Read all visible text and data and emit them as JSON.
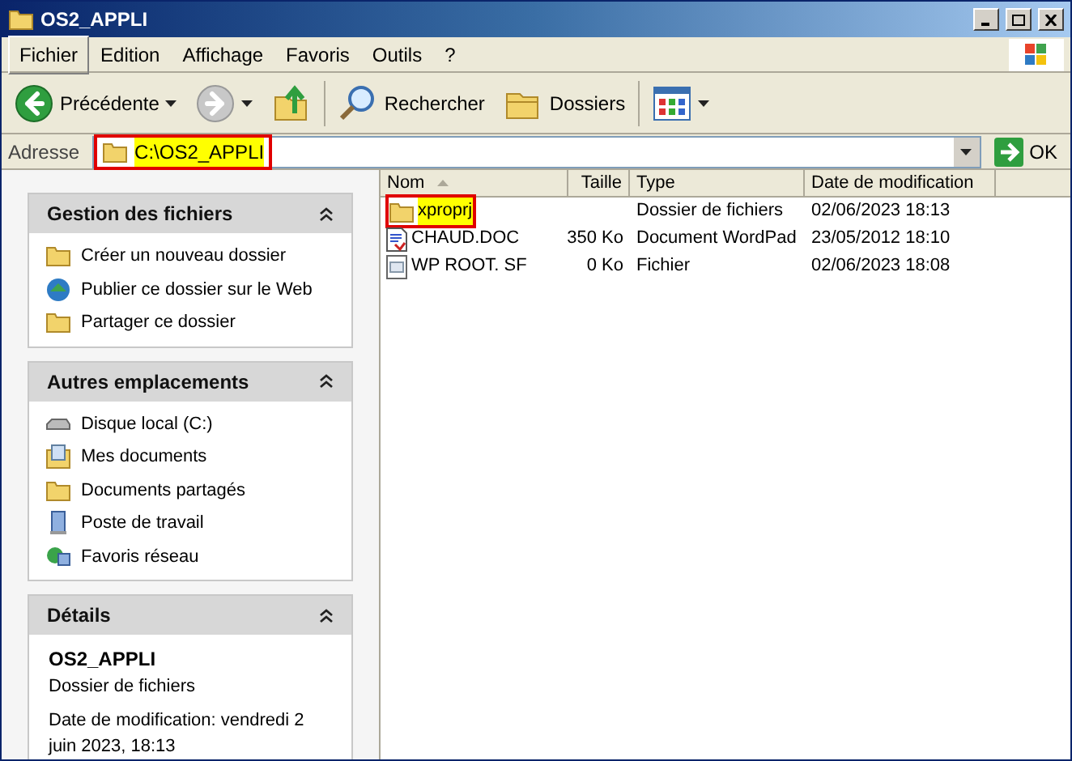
{
  "window": {
    "title": "OS2_APPLI"
  },
  "menu": [
    {
      "label": "Fichier",
      "selected": true
    },
    {
      "label": "Edition",
      "selected": false
    },
    {
      "label": "Affichage",
      "selected": false
    },
    {
      "label": "Favoris",
      "selected": false
    },
    {
      "label": "Outils",
      "selected": false
    },
    {
      "label": "?",
      "selected": false
    }
  ],
  "toolbar": [
    {
      "kind": "back",
      "label": "Précédente",
      "disabled": false
    },
    {
      "kind": "forward",
      "disabled": true
    },
    {
      "kind": "up",
      "disabled": false
    },
    {
      "kind": "search",
      "label": "Rechercher",
      "disabled": false
    },
    {
      "kind": "folders",
      "label": "Dossiers",
      "disabled": false
    },
    {
      "kind": "views",
      "disabled": false
    }
  ],
  "address": {
    "label": "Adresse",
    "value": "C:\\OS2_APPLI",
    "highlighted": true,
    "go": "OK"
  },
  "sidebar": {
    "panels": [
      {
        "kind": "links",
        "title": "Gestion des fichiers",
        "expanded": true,
        "items": [
          "Créer un nouveau dossier",
          "Publier ce dossier sur le Web",
          "Partager ce dossier"
        ]
      },
      {
        "kind": "links",
        "title": "Autres emplacements",
        "expanded": true,
        "items": [
          "Disque local (C:)",
          "Mes documents",
          "Documents partagés",
          "Poste de travail",
          "Favoris réseau"
        ]
      },
      {
        "kind": "details",
        "title": "Détails",
        "expanded": true,
        "name": "OS2_APPLI",
        "type": "Dossier de fichiers",
        "date": "Date de modification: vendredi 2 juin 2023, 18:13"
      }
    ]
  },
  "table": {
    "columns": [
      {
        "label": "Nom",
        "sorted": true
      },
      {
        "label": "Taille",
        "sorted": false
      },
      {
        "label": "Type",
        "sorted": false
      },
      {
        "label": "Date de modification",
        "sorted": false
      }
    ],
    "rows": [
      {
        "kind": "folder",
        "name": "xproprj",
        "size": "",
        "type": "Dossier de fichiers",
        "date": "02/06/2023 18:13",
        "highlighted": true
      },
      {
        "kind": "doc",
        "name": "CHAUD.DOC",
        "size": "350 Ko",
        "type": "Document WordPad",
        "date": "23/05/2012 18:10",
        "highlighted": false
      },
      {
        "kind": "file",
        "name": "WP ROOT. SF",
        "size": "0 Ko",
        "type": "Fichier",
        "date": "02/06/2023 18:08",
        "highlighted": false
      }
    ]
  }
}
